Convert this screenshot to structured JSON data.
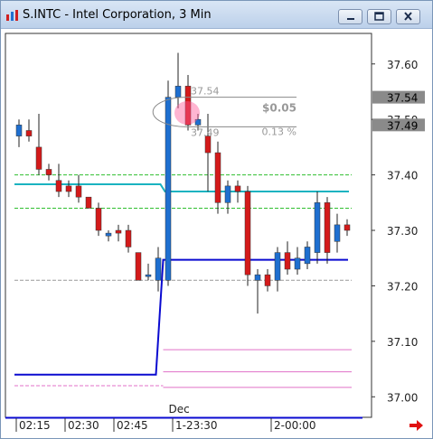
{
  "window": {
    "title": "S.INTC - Intel Corporation, 3 Min",
    "buttons": [
      "minimize",
      "maximize",
      "close"
    ]
  },
  "chart_data": {
    "type": "candlestick",
    "symbol": "S.INTC",
    "name": "Intel Corporation",
    "interval": "3 Min",
    "y_ticks": [
      "37.60",
      "37.50",
      "37.40",
      "37.30",
      "37.20",
      "37.10",
      "37.00"
    ],
    "ylim": [
      36.963,
      37.655
    ],
    "x_ticks": [
      "02:15",
      "02:30",
      "02:45",
      "1-23:30",
      "2-00:00"
    ],
    "date_label": "Dec",
    "price_markers": [
      "37.54",
      "37.49"
    ],
    "candles": [
      {
        "o": 37.47,
        "h": 37.5,
        "l": 37.45,
        "c": 37.49
      },
      {
        "o": 37.48,
        "h": 37.5,
        "l": 37.46,
        "c": 37.47
      },
      {
        "o": 37.45,
        "h": 37.51,
        "l": 37.4,
        "c": 37.41
      },
      {
        "o": 37.41,
        "h": 37.42,
        "l": 37.39,
        "c": 37.4
      },
      {
        "o": 37.39,
        "h": 37.42,
        "l": 37.36,
        "c": 37.37
      },
      {
        "o": 37.38,
        "h": 37.39,
        "l": 37.36,
        "c": 37.37
      },
      {
        "o": 37.38,
        "h": 37.4,
        "l": 37.35,
        "c": 37.36
      },
      {
        "o": 37.36,
        "h": 37.36,
        "l": 37.34,
        "c": 37.34
      },
      {
        "o": 37.34,
        "h": 37.35,
        "l": 37.29,
        "c": 37.3
      },
      {
        "o": 37.29,
        "h": 37.3,
        "l": 37.28,
        "c": 37.295
      },
      {
        "o": 37.3,
        "h": 37.31,
        "l": 37.28,
        "c": 37.295
      },
      {
        "o": 37.3,
        "h": 37.31,
        "l": 37.26,
        "c": 37.27
      },
      {
        "o": 37.26,
        "h": 37.26,
        "l": 37.21,
        "c": 37.21
      },
      {
        "o": 37.22,
        "h": 37.24,
        "l": 37.21,
        "c": 37.22
      },
      {
        "o": 37.21,
        "h": 37.27,
        "l": 37.19,
        "c": 37.25
      },
      {
        "o": 37.21,
        "h": 37.57,
        "l": 37.2,
        "c": 37.54
      },
      {
        "o": 37.54,
        "h": 37.62,
        "l": 37.52,
        "c": 37.56
      },
      {
        "o": 37.56,
        "h": 37.58,
        "l": 37.48,
        "c": 37.49
      },
      {
        "o": 37.49,
        "h": 37.51,
        "l": 37.48,
        "c": 37.5
      },
      {
        "o": 37.47,
        "h": 37.51,
        "l": 37.37,
        "c": 37.44
      },
      {
        "o": 37.44,
        "h": 37.46,
        "l": 37.33,
        "c": 37.35
      },
      {
        "o": 37.35,
        "h": 37.39,
        "l": 37.33,
        "c": 37.38
      },
      {
        "o": 37.38,
        "h": 37.39,
        "l": 37.35,
        "c": 37.37
      },
      {
        "o": 37.37,
        "h": 37.38,
        "l": 37.2,
        "c": 37.22
      },
      {
        "o": 37.21,
        "h": 37.23,
        "l": 37.15,
        "c": 37.22
      },
      {
        "o": 37.22,
        "h": 37.23,
        "l": 37.19,
        "c": 37.2
      },
      {
        "o": 37.21,
        "h": 37.27,
        "l": 37.19,
        "c": 37.26
      },
      {
        "o": 37.26,
        "h": 37.28,
        "l": 37.22,
        "c": 37.23
      },
      {
        "o": 37.23,
        "h": 37.27,
        "l": 37.22,
        "c": 37.25
      },
      {
        "o": 37.24,
        "h": 37.28,
        "l": 37.23,
        "c": 37.27
      },
      {
        "o": 37.26,
        "h": 37.37,
        "l": 37.24,
        "c": 37.35
      },
      {
        "o": 37.35,
        "h": 37.36,
        "l": 37.24,
        "c": 37.26
      },
      {
        "o": 37.28,
        "h": 37.33,
        "l": 37.26,
        "c": 37.31
      },
      {
        "o": 37.31,
        "h": 37.32,
        "l": 37.29,
        "c": 37.3
      }
    ],
    "session1_count": 15,
    "levels": {
      "cyan": [
        {
          "from": 0,
          "to": 14,
          "y": 37.383
        },
        {
          "from": 15,
          "to": 33,
          "y": 37.37
        }
      ],
      "blue": [
        {
          "from": 0,
          "to": 14,
          "y": 37.04
        },
        {
          "from": 15,
          "to": 33,
          "y": 37.247
        }
      ],
      "green_dashed": [
        37.4,
        37.34
      ],
      "gray_dashed": 37.21,
      "pink_session1": [
        37.02
      ],
      "pink_session2": [
        37.085,
        37.045,
        37.017
      ]
    },
    "measure": {
      "high_label": "37.54",
      "low_label": "37.49",
      "change": "$0.05",
      "change_pct": "0.13 %"
    },
    "colors": {
      "up": "#1e6fd0",
      "down": "#d41a1a",
      "cyan": "#1ab3c0",
      "blue": "#0a0ad0",
      "green": "#2fbf2f",
      "pink": "#e070c8",
      "gray": "#999999",
      "marker_bg": "#8a8a8a",
      "highlight": "#ff5c9a"
    }
  }
}
